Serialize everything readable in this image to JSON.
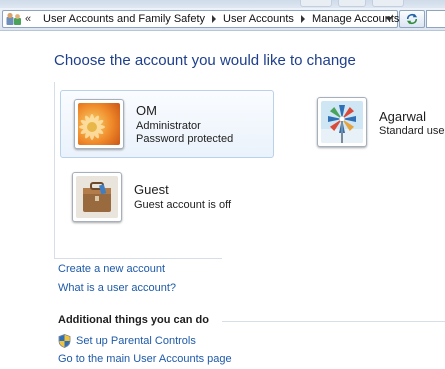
{
  "address_bar": {
    "chevron": "«",
    "crumbs": [
      "User Accounts and Family Safety",
      "User Accounts",
      "Manage Accounts"
    ],
    "refresh_icon": "refresh-arrows-icon"
  },
  "page_title": "Choose the account you would like to change",
  "accounts": [
    {
      "name": "OM",
      "lines": [
        "Administrator",
        "Password protected"
      ],
      "picture": "orange-flower"
    },
    {
      "name": "Agarwal",
      "lines": [
        "Standard user"
      ],
      "picture": "pinwheel"
    },
    {
      "name": "Guest",
      "lines": [
        "Guest account is off"
      ],
      "picture": "briefcase"
    }
  ],
  "links": {
    "create_account": "Create a new account",
    "what_is_account": "What is a user account?"
  },
  "additional": {
    "heading": "Additional things you can do",
    "parental_controls": "Set up Parental Controls",
    "main_page": "Go to the main User Accounts page"
  },
  "colors": {
    "title": "#1e3f8c",
    "link": "#1e5aa8",
    "selection_border": "#b9d2ec"
  }
}
